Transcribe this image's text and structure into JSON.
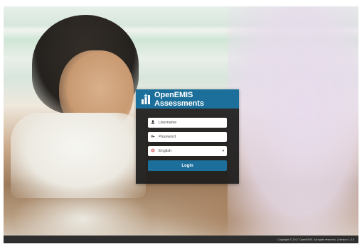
{
  "app": {
    "title": "OpenEMIS Assessments",
    "brand_color": "#1c6f9a"
  },
  "login": {
    "username": {
      "placeholder": "Username",
      "icon": "user-icon"
    },
    "password": {
      "placeholder": "Password",
      "icon": "key-icon"
    },
    "language": {
      "value": "English",
      "icon": "globe-icon",
      "chevron": "▾"
    },
    "submit_label": "Login"
  },
  "footer": {
    "text": "Copyright © 2017 OpenEMIS. All rights reserved. | Version 1.0.0"
  }
}
